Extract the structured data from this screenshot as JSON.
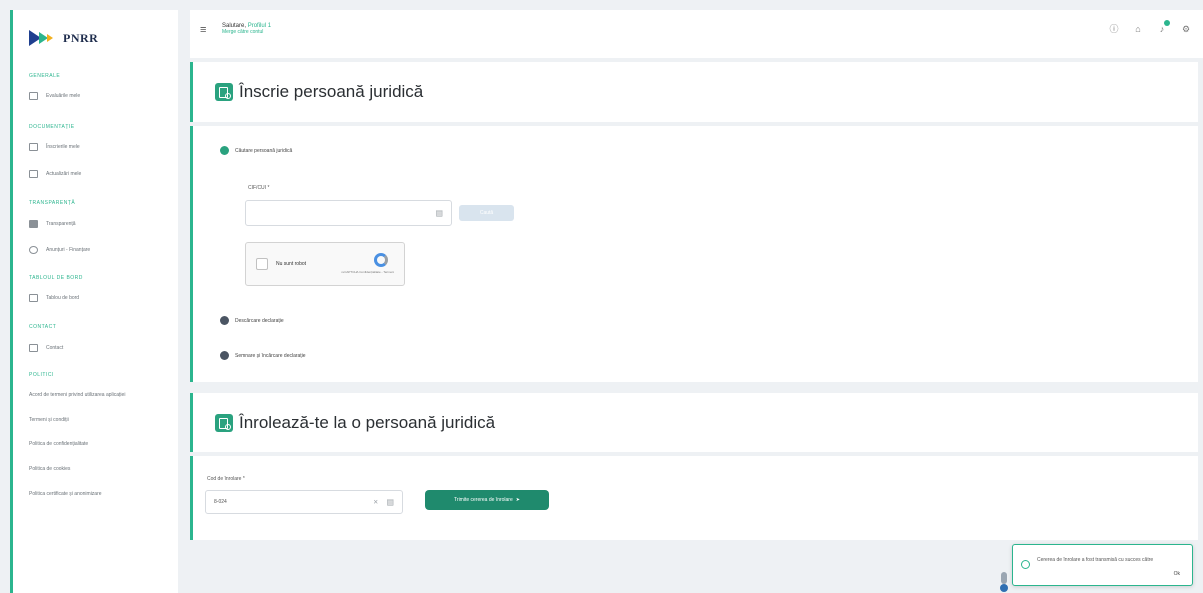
{
  "app": {
    "logo_text": "PNRR",
    "colors": {
      "accent": "#2bb58e",
      "primary_button": "#1f8a6d",
      "brand_blue": "#1f3f8f",
      "brand_yellow": "#f2b01e"
    }
  },
  "header": {
    "user_name": "Salutare,",
    "user_role": "Profilul 1",
    "user_sub": "Merge către contul",
    "icons": [
      "help-icon",
      "home-icon",
      "notification-icon",
      "settings-icon"
    ]
  },
  "sidebar": {
    "sections": [
      {
        "label": "Generale",
        "items": [
          {
            "label": "Evaluările mele",
            "icon": "document-icon"
          }
        ]
      },
      {
        "label": "Documentație",
        "items": [
          {
            "label": "Înscrierile mele",
            "icon": "folder-icon"
          },
          {
            "label": "Actualizări mele",
            "icon": "file-icon"
          }
        ]
      },
      {
        "label": "Transparență",
        "items": [
          {
            "label": "Transparență",
            "icon": "grid-icon"
          },
          {
            "label": "Anunțuri - Finanțare",
            "icon": "globe-icon"
          }
        ]
      },
      {
        "label": "Tabloul de bord",
        "items": [
          {
            "label": "Tablou de bord",
            "icon": "monitor-icon"
          }
        ]
      },
      {
        "label": "Contact",
        "items": [
          {
            "label": "Contact",
            "icon": "mail-icon"
          }
        ]
      }
    ],
    "policies_label": "Politici",
    "policies": [
      "Acord de termeni privind utilizarea aplicației",
      "Termeni și condiții",
      "Politica de confidențialitate",
      "Politica de cookies",
      "Politica certificate și anonimizare"
    ]
  },
  "card1": {
    "title": "Înscrie persoană juridică",
    "steps": [
      {
        "label": "Căutare persoană juridică",
        "active": true
      },
      {
        "label": "Descărcare declarație",
        "active": false
      },
      {
        "label": "Semnare și încărcare declarație",
        "active": false
      }
    ],
    "cui_label": "CIF/CUI *",
    "cui_value": "",
    "search_button": "Caută",
    "captcha_label": "Nu sunt robot",
    "captcha_brand": "reCAPTCHA\nConfidențialitate - Termeni"
  },
  "card2": {
    "title": "Înrolează-te la o persoană juridică",
    "code_label": "Cod de înrolare *",
    "code_value": "8-024",
    "submit_button": "Trimite cererea de înrolare"
  },
  "toast": {
    "message": "Cererea de înrolare a fost transmisă cu succes către",
    "ok": "Ok"
  }
}
